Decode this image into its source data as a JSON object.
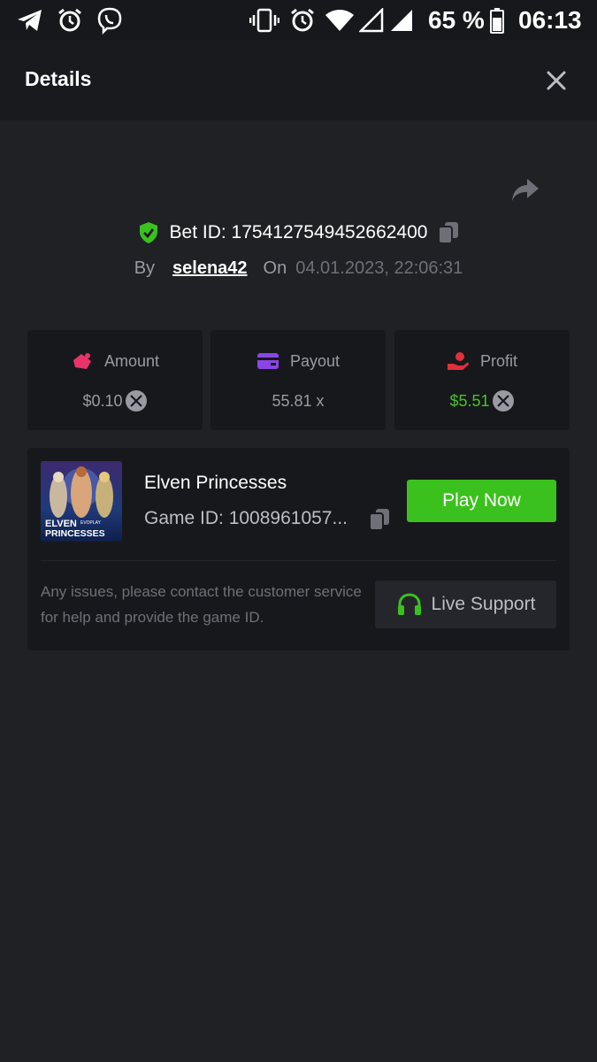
{
  "status_bar": {
    "battery_percent": "65 %",
    "time": "06:13",
    "icons": [
      "telegram-icon",
      "alarm-icon",
      "viber-icon",
      "vibrate-icon",
      "alarm-icon",
      "wifi-icon",
      "signal-empty-icon",
      "signal-icon",
      "battery-icon"
    ]
  },
  "header": {
    "title": "Details",
    "close_icon": "close-icon"
  },
  "bet": {
    "share_icon": "share-icon",
    "id_label": "Bet ID: 1754127549452662400",
    "by_label": "By",
    "username": "selena42",
    "on_label": "On",
    "datetime": "04.01.2023, 22:06:31"
  },
  "stats": {
    "amount": {
      "label": "Amount",
      "value": "$0.10"
    },
    "payout": {
      "label": "Payout",
      "value": "55.81 x"
    },
    "profit": {
      "label": "Profit",
      "value": "$5.51"
    }
  },
  "game": {
    "thumb_title_line1": "ELVEN",
    "thumb_brand": "EVOPLAY",
    "thumb_title_line2": "PRINCESSES",
    "name": "Elven Princesses",
    "id_label": "Game ID: 1008961057...",
    "play_label": "Play Now",
    "help_text": "Any issues, please contact the customer service for help and provide the game ID.",
    "support_label": "Live Support"
  },
  "colors": {
    "background": "#202125",
    "card": "#17181b",
    "accent_green": "#3bc11d",
    "profit_green": "#47c42a",
    "amount_icon": "#e8336b",
    "payout_icon": "#8a45e6",
    "profit_icon": "#e0303a"
  }
}
